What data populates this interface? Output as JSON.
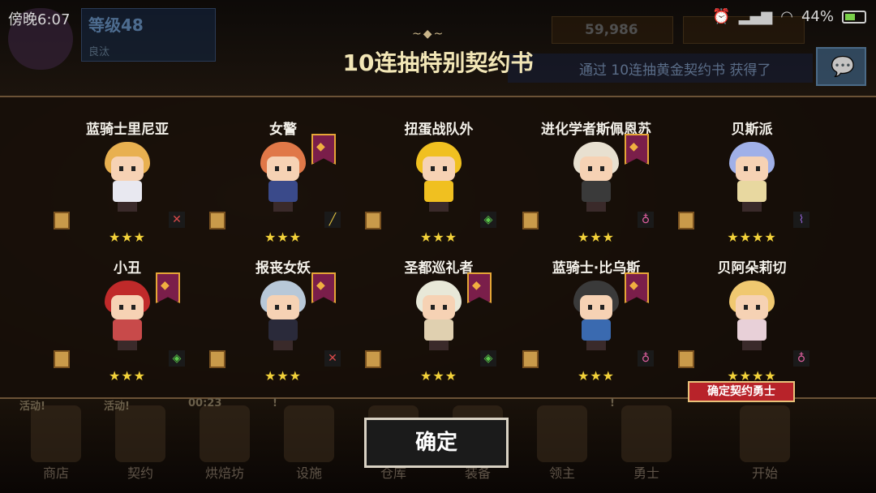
{
  "status_bar": {
    "time": "傍晚6:07",
    "battery": "44%"
  },
  "hud": {
    "level_title": "等级48",
    "level_sub": "良汰",
    "gold": "59,986",
    "ticker": "通过 10连抽黄金契约书 获得了"
  },
  "title": "10连抽特别契约书",
  "title_deco": "~◆~",
  "cards": [
    {
      "name": "蓝骑士里尼亚",
      "stars": "★★★",
      "banner": false,
      "element": "✕",
      "element_color": "#d84a4a",
      "hair": "#e8b050",
      "body": "#e8e8f0"
    },
    {
      "name": "女警",
      "stars": "★★★",
      "banner": true,
      "element": "╱",
      "element_color": "#e0c040",
      "hair": "#e07848",
      "body": "#3a4a8a"
    },
    {
      "name": "扭蛋战队外",
      "stars": "★★★",
      "banner": false,
      "element": "◈",
      "element_color": "#5ac84a",
      "hair": "#f0c020",
      "body": "#f0c020"
    },
    {
      "name": "进化学者斯佩恩苏",
      "stars": "★★★",
      "banner": true,
      "element": "♁",
      "element_color": "#e060a0",
      "hair": "#e8e0d0",
      "body": "#3a3a3a"
    },
    {
      "name": "贝斯派",
      "stars": "★★★★",
      "banner": false,
      "element": "⌇",
      "element_color": "#9060d0",
      "hair": "#a0b0e8",
      "body": "#e8d8a0"
    },
    {
      "name": "小丑",
      "stars": "★★★",
      "banner": true,
      "element": "◈",
      "element_color": "#5ac84a",
      "hair": "#c02a2a",
      "body": "#c84a4a"
    },
    {
      "name": "报丧女妖",
      "stars": "★★★",
      "banner": true,
      "element": "✕",
      "element_color": "#d84a4a",
      "hair": "#b8c8d8",
      "body": "#2a2a3a"
    },
    {
      "name": "圣都巡礼者",
      "stars": "★★★",
      "banner": true,
      "element": "◈",
      "element_color": "#5ac84a",
      "hair": "#e8e8d8",
      "body": "#e0d0b0"
    },
    {
      "name": "蓝骑士·比乌斯",
      "stars": "★★★",
      "banner": true,
      "element": "♁",
      "element_color": "#e060a0",
      "hair": "#3a3a3a",
      "body": "#3a6ab0"
    },
    {
      "name": "贝阿朵莉切",
      "stars": "★★★★",
      "banner": false,
      "element": "♁",
      "element_color": "#e060a0",
      "hair": "#f0c870",
      "body": "#e8d0d8"
    }
  ],
  "confirm_tag": "确定契约勇士",
  "ok_button": "确定",
  "nav": [
    {
      "label": "商店",
      "badge": "活动!"
    },
    {
      "label": "契约",
      "badge": "活动!"
    },
    {
      "label": "烘焙坊",
      "badge": "00:23"
    },
    {
      "label": "设施",
      "badge": "!"
    },
    {
      "label": "仓库",
      "badge": ""
    },
    {
      "label": "装备",
      "badge": ""
    },
    {
      "label": "领主",
      "badge": ""
    },
    {
      "label": "勇士",
      "badge": "!"
    },
    {
      "label": "开始",
      "badge": ""
    }
  ]
}
